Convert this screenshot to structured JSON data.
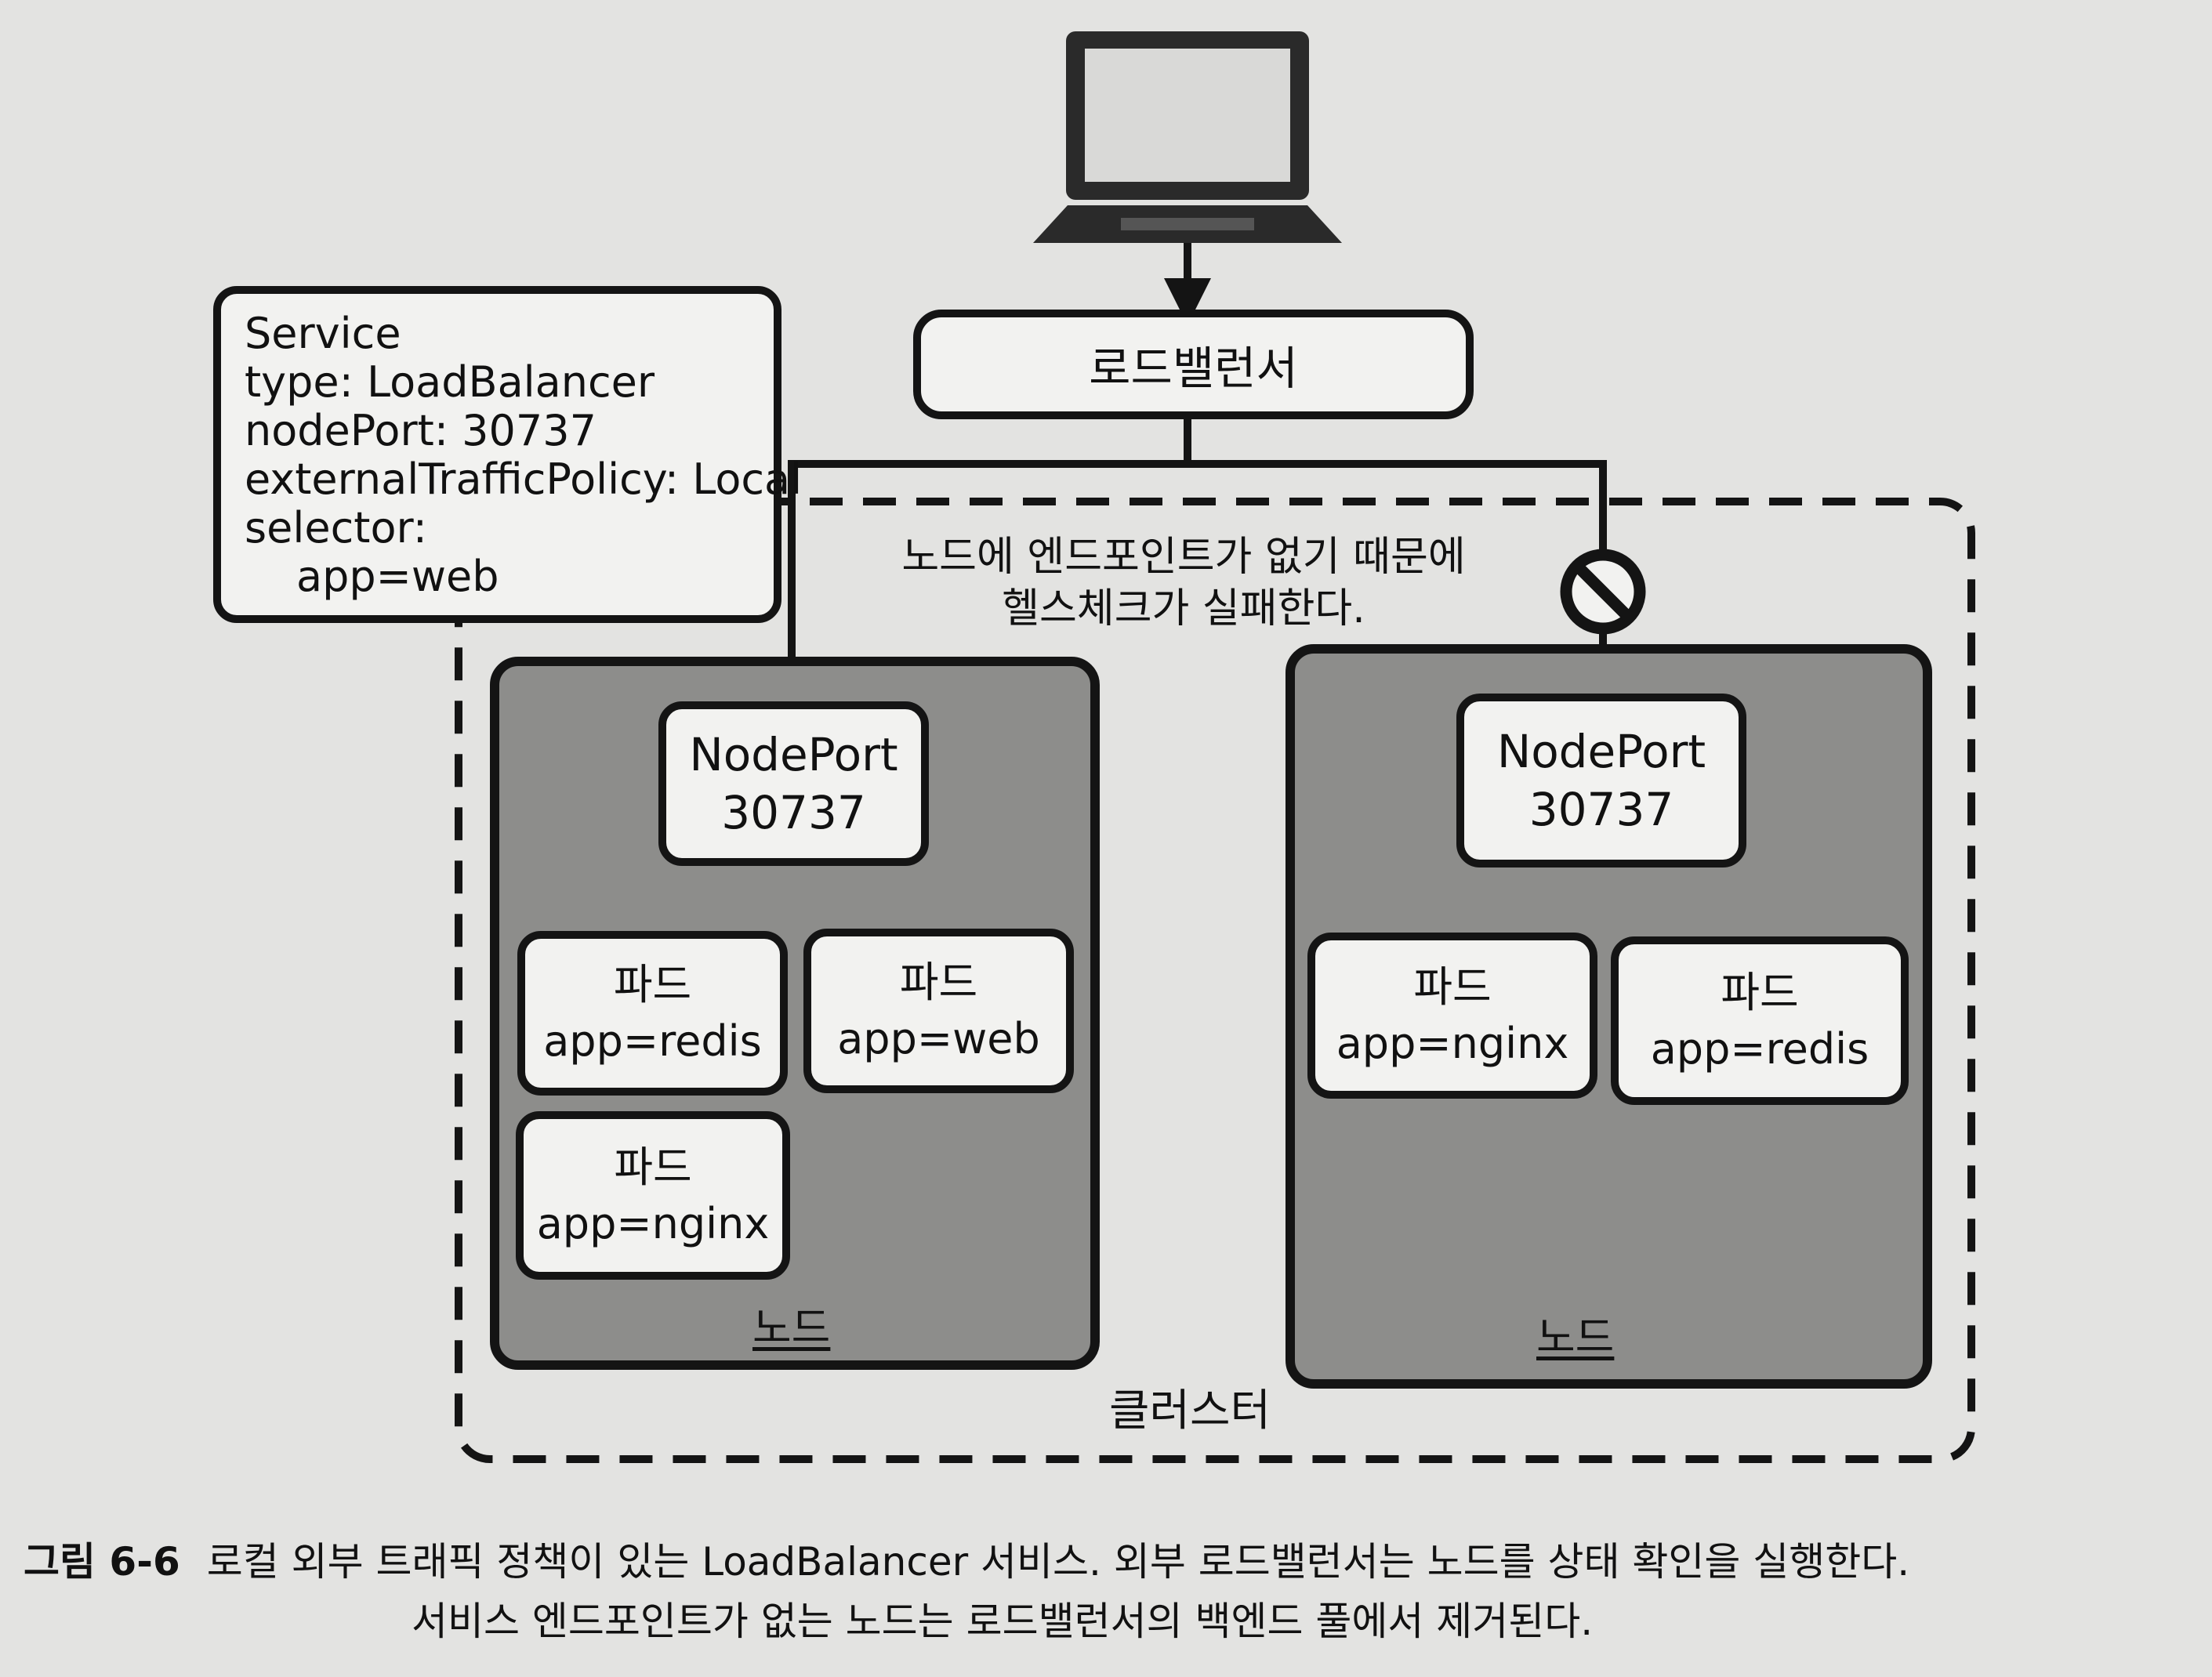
{
  "service": {
    "title": "Service",
    "lines": [
      "type: LoadBalancer",
      "nodePort: 30737",
      "externalTrafficPolicy: Local",
      "selector:"
    ],
    "selector_value": "app=web"
  },
  "load_balancer": {
    "label": "로드밸런서"
  },
  "health_note": {
    "line1": "노드에 엔드포인트가 없기 때문에",
    "line2": "헬스체크가 실패한다."
  },
  "cluster_label": "클러스터",
  "nodes": [
    {
      "label": "노드",
      "nodeport": {
        "line1": "NodePort",
        "line2": "30737"
      },
      "pods": [
        {
          "title": "파드",
          "app": "app=redis"
        },
        {
          "title": "파드",
          "app": "app=web"
        },
        {
          "title": "파드",
          "app": "app=nginx"
        }
      ]
    },
    {
      "label": "노드",
      "nodeport": {
        "line1": "NodePort",
        "line2": "30737"
      },
      "pods": [
        {
          "title": "파드",
          "app": "app=nginx"
        },
        {
          "title": "파드",
          "app": "app=redis"
        }
      ]
    }
  ],
  "caption": {
    "figure": "그림 6-6",
    "line1": "로컬 외부 트래픽 정책이 있는 LoadBalancer 서비스. 외부 로드밸런서는 노드를 상태 확인을 실행한다.",
    "line2": "서비스 엔드포인트가 없는 노드는 로드밸런서의 백엔드 풀에서 제거된다."
  },
  "icons": [
    "laptop-icon",
    "no-entry-icon"
  ]
}
